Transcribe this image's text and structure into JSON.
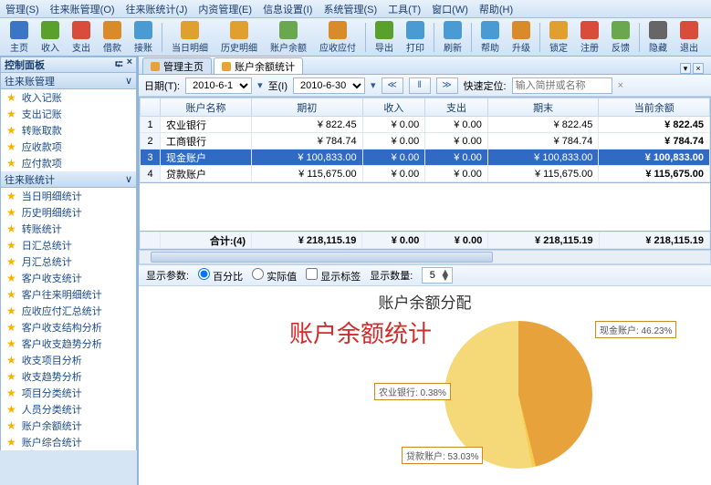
{
  "menu": [
    "管理(S)",
    "往来账管理(O)",
    "往来账统计(J)",
    "内资管理(E)",
    "信息设置(I)",
    "系统管理(S)",
    "工具(T)",
    "窗口(W)",
    "帮助(H)"
  ],
  "toolbar": [
    {
      "label": "主页",
      "color": "#3a76c4"
    },
    {
      "label": "收入",
      "color": "#5aa02c"
    },
    {
      "label": "支出",
      "color": "#d94b3a"
    },
    {
      "label": "借款",
      "color": "#d98b2a"
    },
    {
      "label": "接账",
      "color": "#4a9bd4"
    },
    {
      "sep": true
    },
    {
      "label": "当日明细",
      "color": "#e0a030"
    },
    {
      "label": "历史明细",
      "color": "#e0a030"
    },
    {
      "label": "账户余额",
      "color": "#6aa84f"
    },
    {
      "label": "应收应付",
      "color": "#d98b2a"
    },
    {
      "sep": true
    },
    {
      "label": "导出",
      "color": "#5aa02c"
    },
    {
      "label": "打印",
      "color": "#4a9bd4"
    },
    {
      "sep": true
    },
    {
      "label": "刷新",
      "color": "#4a9bd4"
    },
    {
      "sep": true
    },
    {
      "label": "帮助",
      "color": "#4a9bd4"
    },
    {
      "label": "升级",
      "color": "#d98b2a"
    },
    {
      "sep": true
    },
    {
      "label": "锁定",
      "color": "#e0a030"
    },
    {
      "label": "注册",
      "color": "#d94b3a"
    },
    {
      "label": "反馈",
      "color": "#6aa84f"
    },
    {
      "sep": true
    },
    {
      "label": "隐藏",
      "color": "#666"
    },
    {
      "label": "退出",
      "color": "#d94b3a"
    }
  ],
  "sidebar": {
    "panel_title": "控制面板",
    "pin": "⮓",
    "close": "×",
    "groups": [
      {
        "title": "往来账管理",
        "arrow": "∨",
        "items": [
          "收入记账",
          "支出记账",
          "转账取款",
          "应收款项",
          "应付款项"
        ]
      },
      {
        "title": "往来账统计",
        "arrow": "∨",
        "items": [
          "当日明细统计",
          "历史明细统计",
          "转账统计",
          "日汇总统计",
          "月汇总统计",
          "客户收支统计",
          "客户往来明细统计",
          "应收应付汇总统计",
          "客户收支结构分析",
          "客户收支趋势分析",
          "收支项目分析",
          "收支趋势分析",
          "项目分类统计",
          "人员分类统计",
          "账户余额统计",
          "账户综合统计"
        ]
      }
    ]
  },
  "tabs": [
    {
      "label": "管理主页"
    },
    {
      "label": "账户余额统计",
      "active": true
    }
  ],
  "filter": {
    "date_label": "日期(T):",
    "date_from": "2010-6-1",
    "to": "至(I)",
    "date_to": "2010-6-30",
    "quick_label": "快速定位:",
    "quick_placeholder": "输入简拼或名称"
  },
  "grid": {
    "headers": [
      "",
      "账户名称",
      "期初",
      "收入",
      "支出",
      "期末",
      "当前余额"
    ],
    "rows": [
      {
        "no": "1",
        "name": "农业银行",
        "c1": "¥ 822.45",
        "c2": "¥ 0.00",
        "c3": "¥ 0.00",
        "c4": "¥ 822.45",
        "c5": "¥ 822.45"
      },
      {
        "no": "2",
        "name": "工商银行",
        "c1": "¥ 784.74",
        "c2": "¥ 0.00",
        "c3": "¥ 0.00",
        "c4": "¥ 784.74",
        "c5": "¥ 784.74"
      },
      {
        "no": "3",
        "name": "现金账户",
        "c1": "¥ 100,833.00",
        "c2": "¥ 0.00",
        "c3": "¥ 0.00",
        "c4": "¥ 100,833.00",
        "c5": "¥ 100,833.00",
        "sel": true
      },
      {
        "no": "4",
        "name": "贷款账户",
        "c1": "¥ 115,675.00",
        "c2": "¥ 0.00",
        "c3": "¥ 0.00",
        "c4": "¥ 115,675.00",
        "c5": "¥ 115,675.00"
      }
    ],
    "sum": {
      "label": "合计:(4)",
      "c1": "¥ 218,115.19",
      "c2": "¥ 0.00",
      "c3": "¥ 0.00",
      "c4": "¥ 218,115.19",
      "c5": "¥ 218,115.19"
    }
  },
  "chartopts": {
    "param_label": "显示参数:",
    "radio1": "百分比",
    "radio2": "实际值",
    "cb": "显示标签",
    "count_label": "显示数量:",
    "count": "5"
  },
  "chart_data": {
    "type": "pie",
    "title": "账户余额分配",
    "overlay": "账户余额统计",
    "series": [
      {
        "name": "现金账户",
        "value": 46.23,
        "label": "现金账户: 46.23%"
      },
      {
        "name": "农业银行",
        "value": 0.38,
        "label": "农业银行: 0.38%"
      },
      {
        "name": "贷款账户",
        "value": 53.03,
        "label": "贷款账户: 53.03%"
      }
    ]
  }
}
